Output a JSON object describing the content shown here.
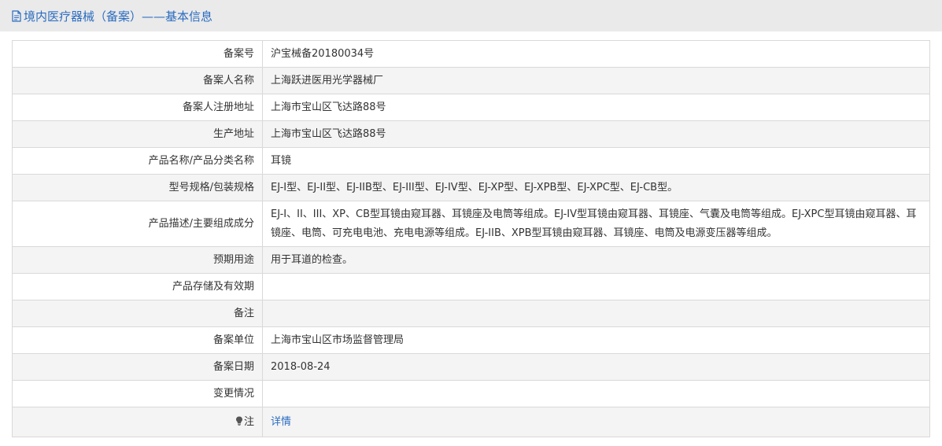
{
  "header": {
    "title": "境内医疗器械（备案）——基本信息"
  },
  "rows": [
    {
      "label": "备案号",
      "value": "沪宝械备20180034号"
    },
    {
      "label": "备案人名称",
      "value": "上海跃进医用光学器械厂"
    },
    {
      "label": "备案人注册地址",
      "value": "上海市宝山区飞达路88号"
    },
    {
      "label": "生产地址",
      "value": "上海市宝山区飞达路88号"
    },
    {
      "label": "产品名称/产品分类名称",
      "value": "耳镜"
    },
    {
      "label": "型号规格/包装规格",
      "value": "EJ-I型、EJ-II型、EJ-IIB型、EJ-III型、EJ-IV型、EJ-XP型、EJ-XPB型、EJ-XPC型、EJ-CB型。"
    },
    {
      "label": "产品描述/主要组成成分",
      "value": "EJ-I、II、III、XP、CB型耳镜由窥耳器、耳镜座及电筒等组成。EJ-IV型耳镜由窥耳器、耳镜座、气囊及电筒等组成。EJ-XPC型耳镜由窥耳器、耳镜座、电筒、可充电电池、充电电源等组成。EJ-IIB、XPB型耳镜由窥耳器、耳镜座、电筒及电源变压器等组成。"
    },
    {
      "label": "预期用途",
      "value": "用于耳道的检查。"
    },
    {
      "label": "产品存储及有效期",
      "value": ""
    },
    {
      "label": "备注",
      "value": ""
    },
    {
      "label": "备案单位",
      "value": "上海市宝山区市场监督管理局"
    },
    {
      "label": "备案日期",
      "value": "2018-08-24"
    },
    {
      "label": "变更情况",
      "value": ""
    }
  ],
  "note": {
    "label": "注",
    "link_text": "详情"
  },
  "colors": {
    "accent": "#2a6cc1",
    "header_bg": "#eaeaea",
    "row_alt_bg": "#f4f4f4",
    "border": "#d9d9d9"
  }
}
